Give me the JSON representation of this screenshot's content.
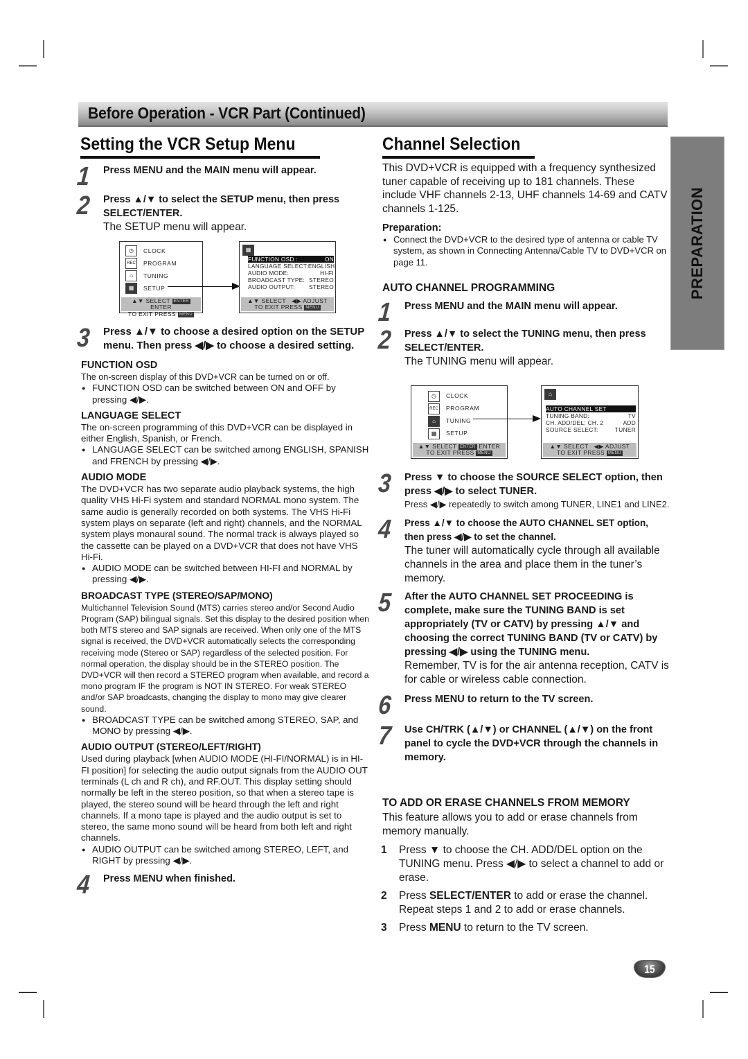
{
  "banner": {
    "title": "Before Operation - VCR Part (Continued)"
  },
  "side_tab": {
    "label": "PREPARATION"
  },
  "page_number": "15",
  "left": {
    "title": "Setting the VCR Setup Menu",
    "steps": [
      {
        "num": "1",
        "head": "Press MENU and the MAIN menu will appear."
      },
      {
        "num": "2",
        "head": "Press ▲/▼ to select the SETUP menu, then press SELECT/ENTER.",
        "sub": "The SETUP menu will appear."
      },
      {
        "num": "3",
        "head": "Press ▲/▼ to choose a desired option on the SETUP menu. Then press ◀/▶ to choose a desired setting."
      },
      {
        "num": "4",
        "head": "Press MENU when finished."
      }
    ],
    "main_menu": {
      "items": [
        {
          "icon": "clock-icon",
          "label": "CLOCK"
        },
        {
          "icon": "rec-icon",
          "label": "PROGRAM"
        },
        {
          "icon": "antenna-icon",
          "label": "TUNING"
        },
        {
          "icon": "setup-icon",
          "label": "SETUP"
        }
      ],
      "footer_line1_a": "▲▼ SELECT",
      "footer_key_enter": "ENTER",
      "footer_line1_b": "ENTER",
      "footer_line2": "TO  EXIT PRESS",
      "footer_key_menu": "MENU"
    },
    "setup_menu": {
      "rows": [
        {
          "label": "FUNCTION OSD :",
          "value": "ON",
          "highlighted": true
        },
        {
          "label": "LANGUAGE SELECT:",
          "value": "ENGLISH"
        },
        {
          "label": "AUDIO MODE:",
          "value": "HI-FI"
        },
        {
          "label": "BROADCAST TYPE:",
          "value": "STEREO"
        },
        {
          "label": "AUDIO OUTPUT:",
          "value": "STEREO"
        }
      ],
      "footer_line1_a": "▲▼ SELECT",
      "footer_line1_b": "◀▶ ADJUST",
      "footer_line2": "TO  EXIT  PRESS",
      "footer_key_menu": "MENU"
    },
    "sections": [
      {
        "heading": "FUNCTION OSD",
        "body": "The on-screen display of this DVD+VCR can be turned on or off.",
        "bullet": "FUNCTION OSD can be switched between ON and OFF by pressing ◀/▶."
      },
      {
        "heading": "LANGUAGE SELECT",
        "body": "The on-screen programming of this DVD+VCR can be displayed in either English, Spanish, or French.",
        "bullet": "LANGUAGE SELECT can be switched among ENGLISH, SPANISH and FRENCH by pressing ◀/▶."
      },
      {
        "heading": "AUDIO MODE",
        "body": "The DVD+VCR has two separate audio playback systems, the high quality VHS Hi-Fi system and standard NORMAL mono system. The same audio is generally recorded on both systems. The VHS Hi-Fi system plays on separate (left and right) channels, and the NORMAL system plays monaural sound. The normal track is always played so the cassette can be played on a DVD+VCR that does not have VHS Hi-Fi.",
        "bullet": "AUDIO MODE can be switched between HI-FI and NORMAL by pressing ◀/▶."
      },
      {
        "heading": "BROADCAST TYPE (STEREO/SAP/MONO)",
        "body": "Multichannel Television Sound (MTS) carries stereo and/or Second Audio Program (SAP) bilingual signals. Set this display to the desired position when both MTS stereo and SAP signals are received. When only one of the MTS signal is received, the DVD+VCR automatically selects the corresponding receiving mode (Stereo or SAP) regardless of the selected position. For normal operation, the display should be in the STEREO position. The DVD+VCR will then record a STEREO program when available, and record a mono program IF the program is NOT IN STEREO. For weak STEREO and/or SAP broadcasts, changing the display to mono may give clearer sound.",
        "bullet": "BROADCAST TYPE can be switched among STEREO, SAP, and MONO by pressing ◀/▶."
      },
      {
        "heading": "AUDIO OUTPUT (STEREO/LEFT/RIGHT)",
        "body": "Used during playback [when AUDIO MODE (HI-FI/NORMAL) is in HI-FI position] for selecting the audio output signals from the AUDIO OUT terminals (L ch and R ch), and RF.OUT. This display setting should normally be left in the stereo position, so that when a stereo tape is played, the stereo sound will be heard through the left and right channels. If a mono tape is played and the audio output is set to stereo, the same mono sound will be heard from both left and right channels.",
        "bullet": "AUDIO OUTPUT can be switched among STEREO, LEFT, and RIGHT by pressing ◀/▶."
      }
    ]
  },
  "right": {
    "title": "Channel Selection",
    "intro": "This DVD+VCR is equipped with a frequency synthesized tuner capable of receiving up to 181 channels. These include VHF channels 2-13, UHF channels 14-69 and CATV channels 1-125.",
    "preparation_heading": "Preparation:",
    "preparation_bullet": "Connect the DVD+VCR to the desired type of antenna or cable TV system, as shown in Connecting Antenna/Cable TV to DVD+VCR on page 11.",
    "auto_heading": "AUTO CHANNEL PROGRAMMING",
    "steps": [
      {
        "num": "1",
        "head": "Press MENU and the MAIN menu will appear."
      },
      {
        "num": "2",
        "head": "Press ▲/▼ to select the TUNING menu, then press SELECT/ENTER.",
        "sub": "The TUNING menu will appear."
      },
      {
        "num": "3",
        "head": "Press ▼ to choose the SOURCE SELECT option, then press ◀/▶ to select TUNER.",
        "small": "Press ◀/▶ repeatedly to switch among TUNER, LINE1 and LINE2."
      },
      {
        "num": "4",
        "head": "Press ▲/▼ to choose the AUTO CHANNEL SET option, then press ◀/▶ to set the channel.",
        "sub": "The tuner will automatically cycle through all available channels in the area and place them in the tuner’s memory."
      },
      {
        "num": "5",
        "head": "After the AUTO CHANNEL SET PROCEEDING is complete, make sure the TUNING BAND is set appropriately (TV or CATV) by pressing ▲/▼ and choosing the correct TUNING BAND (TV or CATV) by pressing ◀/▶ using the TUNING menu.",
        "sub": "Remember, TV is for the air antenna reception, CATV is for cable or wireless  cable connection."
      },
      {
        "num": "6",
        "head": "Press MENU to return to the TV screen."
      },
      {
        "num": "7",
        "head": "Use CH/TRK (▲/▼) or CHANNEL (▲/▼) on the front panel to cycle the DVD+VCR through the channels in memory."
      }
    ],
    "main_menu": {
      "items": [
        {
          "icon": "clock-icon",
          "label": "CLOCK"
        },
        {
          "icon": "rec-icon",
          "label": "PROGRAM"
        },
        {
          "icon": "antenna-icon",
          "label": "TUNING"
        },
        {
          "icon": "setup-icon",
          "label": "SETUP"
        }
      ],
      "footer_line1_a": "▲▼ SELECT",
      "footer_key_enter": "ENTER",
      "footer_line1_b": "ENTER",
      "footer_line2": "TO  EXIT PRESS",
      "footer_key_menu": "MENU"
    },
    "tuning_menu": {
      "rows": [
        {
          "label": "AUTO CHANNEL SET",
          "value": "",
          "highlighted": true
        },
        {
          "label": "TUNING BAND:",
          "value": "TV"
        },
        {
          "label": "CH.  ADD/DEL: CH. 2",
          "value": "ADD"
        },
        {
          "label": "SOURCE  SELECT:",
          "value": "TUNER"
        }
      ],
      "footer_line1_a": "▲▼ SELECT",
      "footer_line1_b": "◀▶ ADJUST",
      "footer_line2": "TO  EXIT  PRESS",
      "footer_key_menu": "MENU"
    },
    "erase_heading": "TO ADD OR ERASE CHANNELS FROM MEMORY",
    "erase_intro": "This feature allows you to add or erase channels from memory manually.",
    "erase_list": [
      {
        "n": "1",
        "text": "Press ▼ to choose the CH. ADD/DEL option on the TUNING menu. Press ◀/▶ to select a channel to add or erase."
      },
      {
        "n": "2",
        "pre": "Press ",
        "bold": "SELECT/ENTER",
        "post": " to add or erase the channel. Repeat steps 1 and 2 to add or erase channels."
      },
      {
        "n": "3",
        "pre": "Press ",
        "bold": "MENU",
        "post": " to return to the TV screen."
      }
    ]
  }
}
